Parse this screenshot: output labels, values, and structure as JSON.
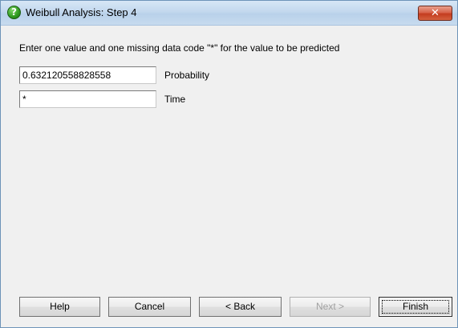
{
  "window": {
    "title": "Weibull Analysis: Step 4",
    "icon": "question-icon",
    "close_glyph": "✕"
  },
  "instruction": "Enter one value and one missing data code \"*\" for the value to be predicted",
  "fields": [
    {
      "label": "Probability",
      "value": "0.632120558828558"
    },
    {
      "label": "Time",
      "value": "*"
    }
  ],
  "buttons": {
    "help": "Help",
    "cancel": "Cancel",
    "back": "< Back",
    "next": "Next >",
    "finish": "Finish"
  }
}
